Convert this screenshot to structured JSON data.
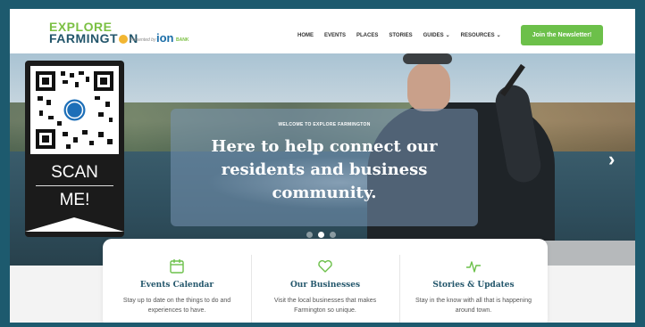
{
  "header": {
    "logo_line1": "EXPLORE",
    "logo_line2_a": "FARMINGT",
    "logo_line2_b": "N",
    "presented_by": "Presented by",
    "sponsor": "ion",
    "sponsor_suffix": "BANK",
    "nav": [
      "HOME",
      "EVENTS",
      "PLACES",
      "STORIES",
      "GUIDES",
      "RESOURCES"
    ],
    "newsletter_label": "Join the Newsletter!"
  },
  "hero": {
    "welcome": "WELCOME TO EXPLORE FARMINGTON",
    "headline": "Here to help connect our residents and business community.",
    "next_arrow": "›"
  },
  "qr": {
    "scan": "SCAN",
    "me": "ME!",
    "badge": "EF"
  },
  "cards": [
    {
      "title": "Events Calendar",
      "desc": "Stay up to date on the things to do and experiences to have.",
      "icon": "calendar-icon"
    },
    {
      "title": "Our Businesses",
      "desc": "Visit the local businesses that makes Farmington so unique.",
      "icon": "heart-icon"
    },
    {
      "title": "Stories & Updates",
      "desc": "Stay in the know with all that is happening around town.",
      "icon": "pulse-icon"
    }
  ],
  "colors": {
    "frame": "#1d5a6e",
    "brand_green": "#6cc04a",
    "brand_blue": "#23566b"
  }
}
